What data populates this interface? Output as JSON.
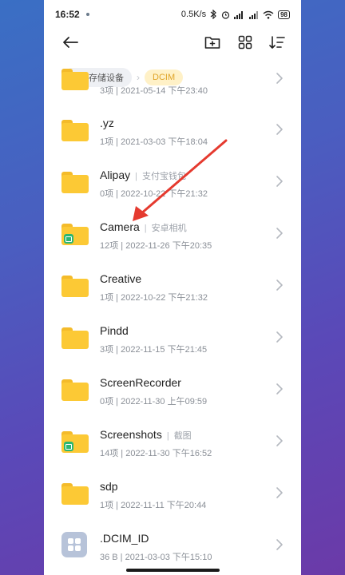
{
  "status_bar": {
    "time": "16:52",
    "speed": "0.5K/s",
    "battery": "98"
  },
  "toolbar": {
    "back_icon": "arrow-left-icon",
    "new_folder_icon": "folder-plus-icon",
    "view_icon": "grid-view-icon",
    "sort_icon": "sort-icon"
  },
  "breadcrumb": {
    "root": "内部存储设备",
    "current": "DCIM"
  },
  "items": [
    {
      "name": "",
      "tag": "",
      "meta": "3项 | 2021-05-14 下午23:40",
      "type": "folder",
      "badge": false
    },
    {
      "name": ".yz",
      "tag": "",
      "meta": "1项 | 2021-03-03 下午18:04",
      "type": "folder",
      "badge": false
    },
    {
      "name": "Alipay",
      "tag": "支付宝钱包",
      "meta": "0项 | 2022-10-22 下午21:32",
      "type": "folder",
      "badge": false
    },
    {
      "name": "Camera",
      "tag": "安卓相机",
      "meta": "12项 | 2022-11-26 下午20:35",
      "type": "folder",
      "badge": true
    },
    {
      "name": "Creative",
      "tag": "",
      "meta": "1项 | 2022-10-22 下午21:32",
      "type": "folder",
      "badge": false
    },
    {
      "name": "Pindd",
      "tag": "",
      "meta": "3项 | 2022-11-15 下午21:45",
      "type": "folder",
      "badge": false
    },
    {
      "name": "ScreenRecorder",
      "tag": "",
      "meta": "0项 | 2022-11-30 上午09:59",
      "type": "folder",
      "badge": false
    },
    {
      "name": "Screenshots",
      "tag": "截图",
      "meta": "14项 | 2022-11-30 下午16:52",
      "type": "folder",
      "badge": true
    },
    {
      "name": "sdp",
      "tag": "",
      "meta": "1项 | 2022-11-11 下午20:44",
      "type": "folder",
      "badge": false
    },
    {
      "name": ".DCIM_ID",
      "tag": "",
      "meta": "36 B | 2021-03-03 下午15:10",
      "type": "file",
      "badge": false
    }
  ],
  "colors": {
    "folder": "#fcc935",
    "badge": "#2bb673",
    "arrow": "#e53a2f",
    "crumb_current": "#e0a52a"
  }
}
